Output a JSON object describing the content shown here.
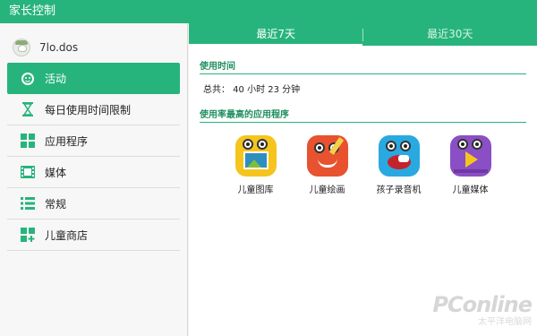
{
  "window": {
    "title": "家长控制"
  },
  "sidebar": {
    "profile": {
      "name": "7lo.dos"
    },
    "items": [
      {
        "label": "活动",
        "icon": "face-icon",
        "active": true
      },
      {
        "label": "每日使用时间限制",
        "icon": "hourglass-icon"
      },
      {
        "label": "应用程序",
        "icon": "apps-grid-icon"
      },
      {
        "label": "媒体",
        "icon": "film-icon"
      },
      {
        "label": "常规",
        "icon": "list-icon"
      },
      {
        "label": "儿童商店",
        "icon": "store-grid-plus-icon"
      }
    ]
  },
  "main": {
    "tabs": [
      {
        "label": "最近7天",
        "active": true
      },
      {
        "label": "最近30天",
        "active": false
      }
    ],
    "usage": {
      "title": "使用时间",
      "total": "总共： 40 小时 23 分钟"
    },
    "top_apps": {
      "title": "使用率最高的应用程序",
      "apps": [
        {
          "name": "儿童图库",
          "color": "#f5c51e"
        },
        {
          "name": "儿童绘画",
          "color": "#e8522f"
        },
        {
          "name": "孩子录音机",
          "color": "#29a9e0"
        },
        {
          "name": "儿童媒体",
          "color": "#8a4fc4"
        }
      ]
    }
  },
  "watermark": {
    "brand": "PConline",
    "sub": "太平洋电脑网"
  },
  "colors": {
    "accent": "#27b47c"
  }
}
